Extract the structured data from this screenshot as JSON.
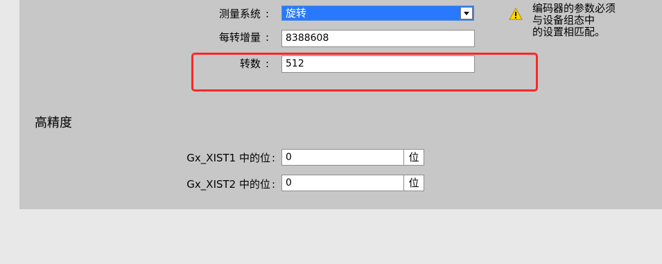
{
  "encoder": {
    "measuring_system": {
      "label": "测量系统",
      "value": "旋转"
    },
    "increments_per_rev": {
      "label": "每转增量",
      "value": "8388608"
    },
    "revolutions": {
      "label": "转数",
      "value": "512"
    },
    "colon": ":",
    "note": "编码器的参数必须\n与设备组态中\n的设置相匹配。"
  },
  "high_precision": {
    "title": "高精度",
    "xist1": {
      "label": "Gx_XIST1 中的位",
      "value": "0",
      "unit": "位"
    },
    "xist2": {
      "label": "Gx_XIST2 中的位",
      "value": "0",
      "unit": "位"
    }
  },
  "colors": {
    "accent": "#2979ff",
    "highlight": "#ff2626",
    "warning": "#ffd800"
  },
  "icons": {
    "warning": "warning-icon",
    "dropdown": "chevron-down-icon"
  }
}
